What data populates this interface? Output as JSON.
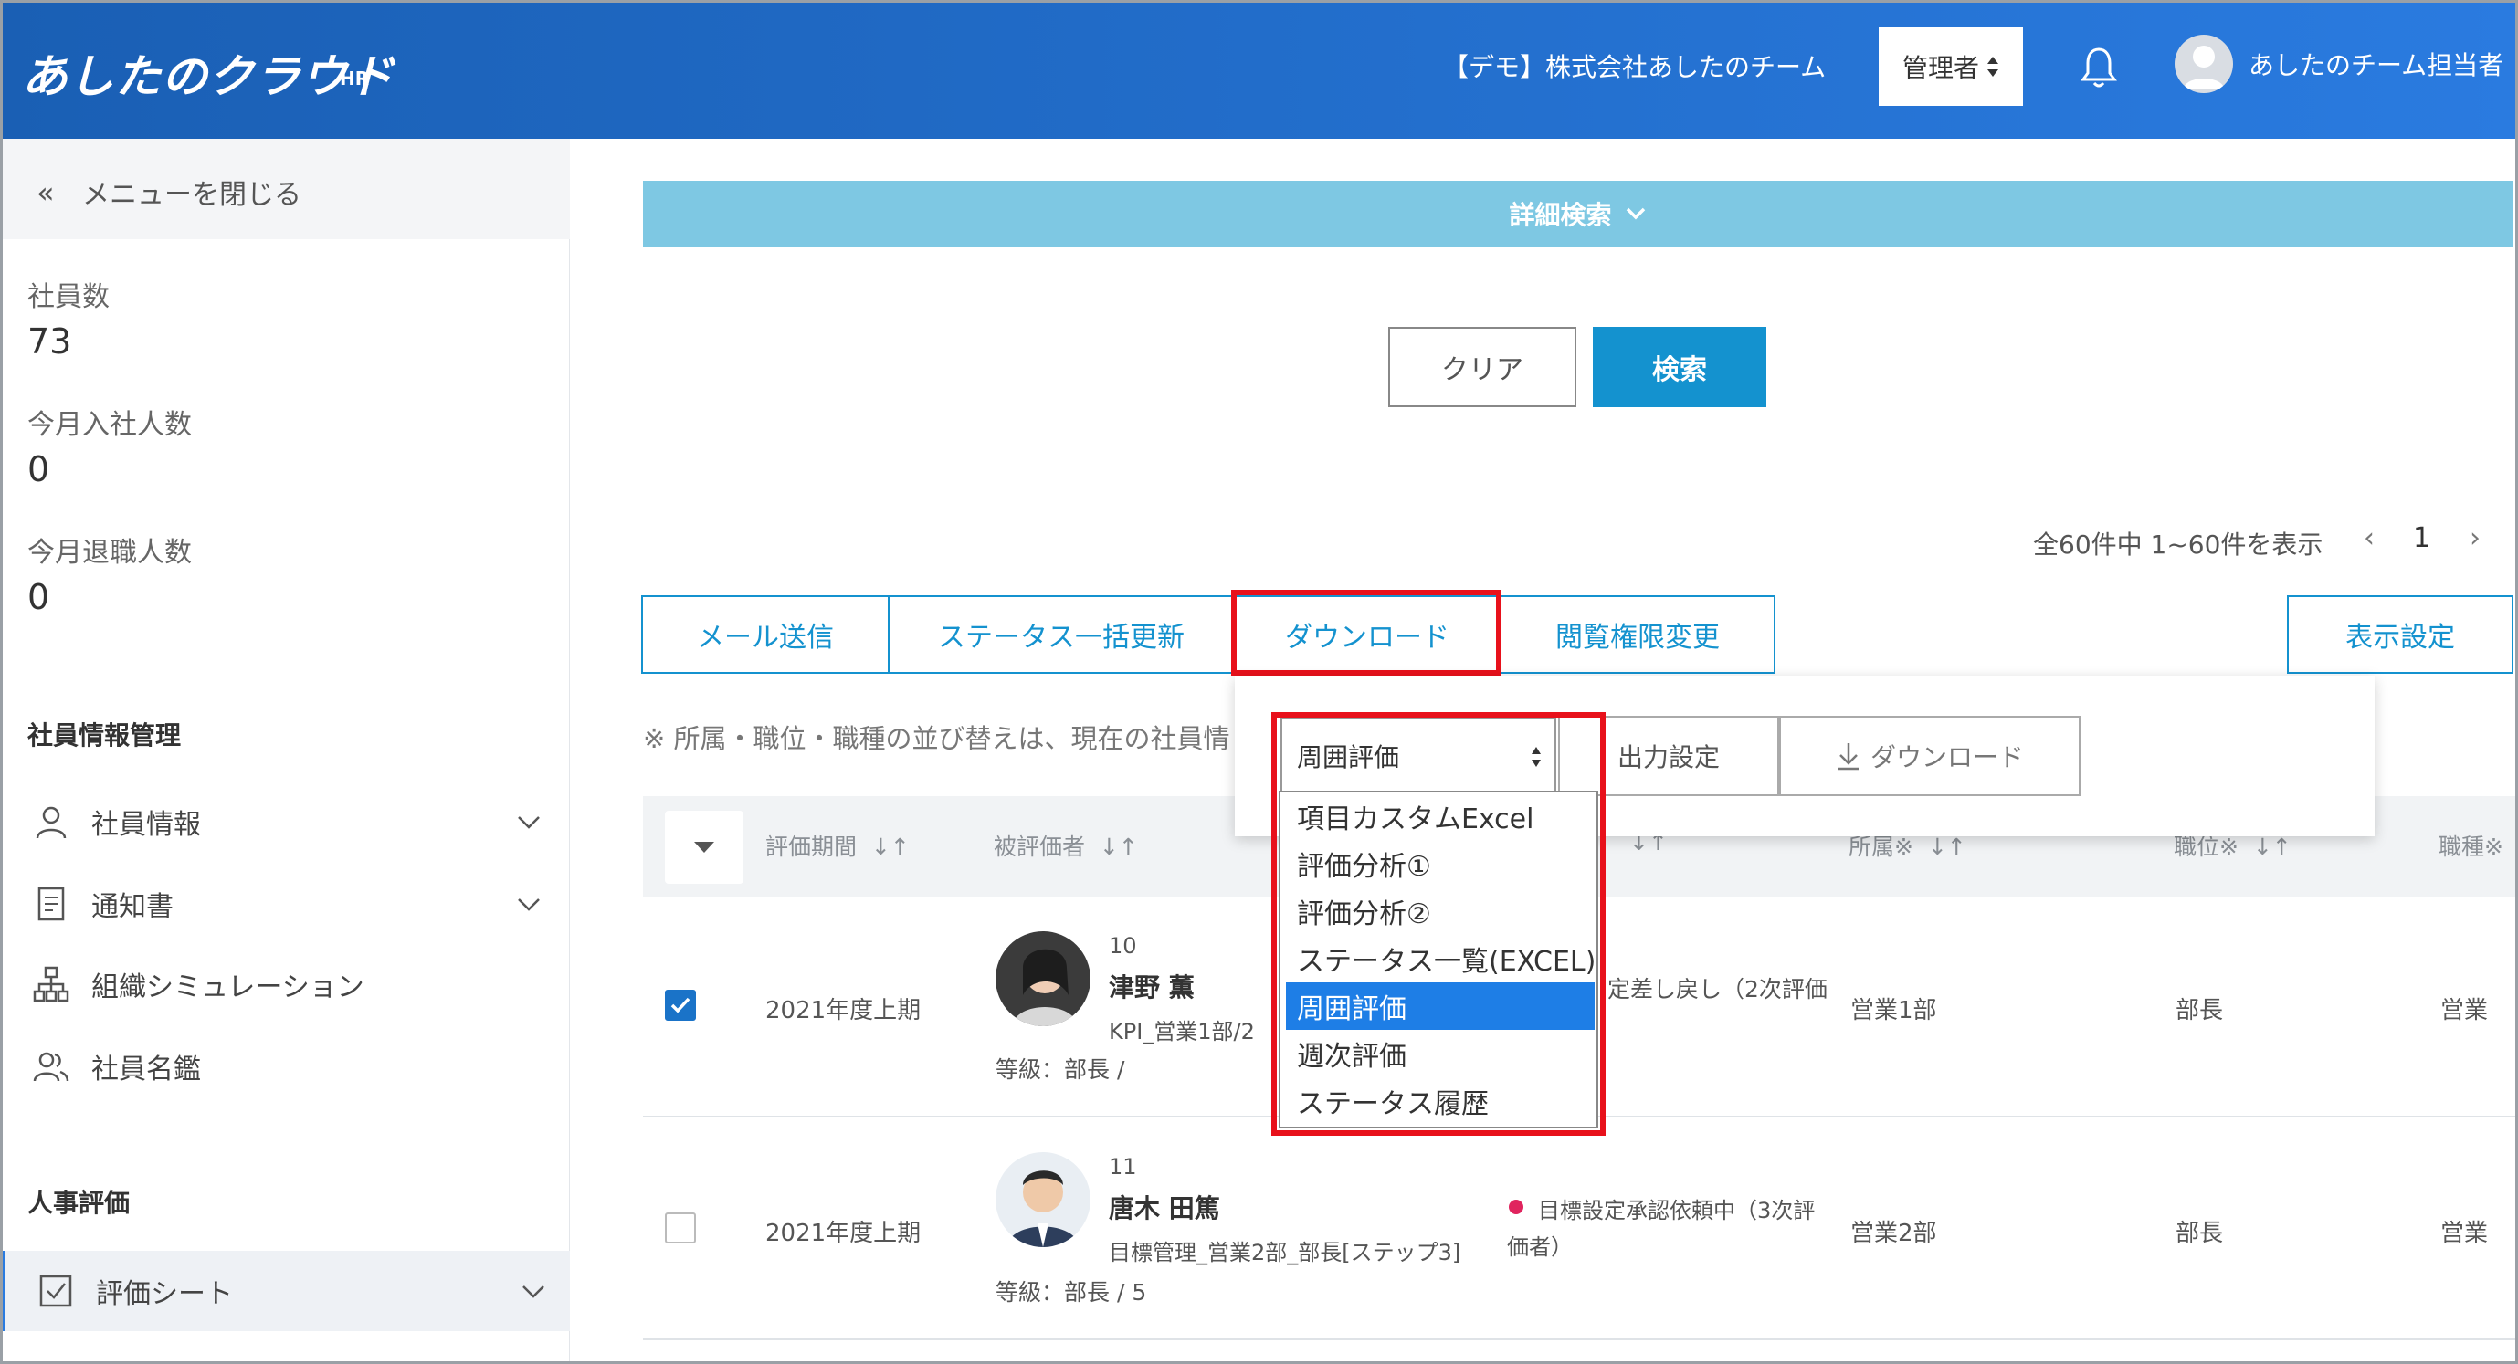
{
  "header": {
    "logo": "あしたのクラウド",
    "logo_sub": "HR",
    "company": "【デモ】株式会社あしたのチーム",
    "role": "管理者",
    "role_icon": "sort-icon",
    "username": "あしたのチーム担当者"
  },
  "sidebar": {
    "close_menu": "メニューを閉じる",
    "stats": [
      {
        "label": "社員数",
        "value": "73"
      },
      {
        "label": "今月入社人数",
        "value": "0"
      },
      {
        "label": "今月退職人数",
        "value": "0"
      }
    ],
    "section1": "社員情報管理",
    "items1": [
      {
        "label": "社員情報",
        "icon": "person-icon"
      },
      {
        "label": "通知書",
        "icon": "document-icon"
      },
      {
        "label": "組織シミュレーション",
        "icon": "org-chart-icon"
      },
      {
        "label": "社員名鑑",
        "icon": "people-icon"
      }
    ],
    "section2": "人事評価",
    "items2": [
      {
        "label": "評価シート",
        "icon": "checklist-icon"
      }
    ]
  },
  "main": {
    "search_toggle": "詳細検索",
    "clear_label": "クリア",
    "search_label": "検索",
    "pager": {
      "summary": "全60件中 1~60件を表示",
      "page": "1",
      "prev": "‹",
      "next": "›"
    },
    "actions": {
      "mail": "メール送信",
      "status_bulk": "ステータス一括更新",
      "download": "ダウンロード",
      "permission": "閲覧権限変更",
      "display_settings": "表示設定"
    },
    "note": "※ 所属・職位・職種の並び替えは、現在の社員情",
    "columns": {
      "period": "評価期間",
      "evaluatee": "被評価者",
      "status_partial": "↓↑",
      "dept": "所属※",
      "position": "職位※",
      "job": "職種※"
    },
    "rows": [
      {
        "checked": true,
        "period": "2021年度上期",
        "no": "10",
        "name": "津野 薫",
        "sheet": "KPI_営業1部/2",
        "grade": "等級：部長 /",
        "status": "定差し戻し（2次評価",
        "dept": "営業1部",
        "position": "部長",
        "job": "営業"
      },
      {
        "checked": false,
        "period": "2021年度上期",
        "no": "11",
        "name": "唐木 田篤",
        "sheet": "目標管理_営業2部_部長[ステップ3]",
        "grade": "等級：部長 / 5",
        "status": "目標設定承認依頼中（3次評",
        "status2": "価者）",
        "status_color": "#e0245e",
        "dept": "営業2部",
        "position": "部長",
        "job": "営業"
      }
    ]
  },
  "download_popup": {
    "selected": "周囲評価",
    "output_settings": "出力設定",
    "download_button": "ダウンロード",
    "options": [
      "項目カスタムExcel",
      "評価分析①",
      "評価分析②",
      "ステータス一覧(EXCEL)",
      "周囲評価",
      "週次評価",
      "ステータス履歴"
    ],
    "highlighted_option": "周囲評価"
  },
  "colors": {
    "header": "#2a7be0",
    "accent": "#1492cf",
    "highlight_box": "#e8111b",
    "option_selected": "#1e7ee6"
  }
}
